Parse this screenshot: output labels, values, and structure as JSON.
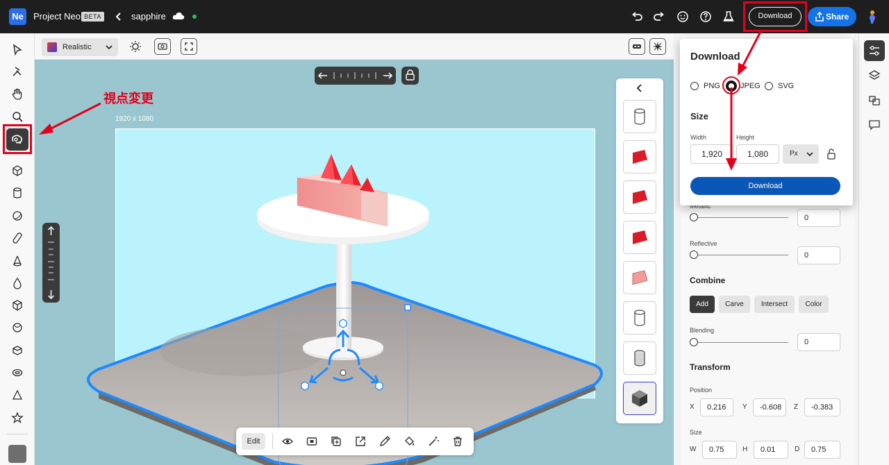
{
  "app": {
    "logo": "Ne",
    "name": "Project Neo",
    "badge": "BETA",
    "document": "sapphire"
  },
  "topbar": {
    "download_label": "Download",
    "share_label": "Share",
    "icons": [
      "back-icon",
      "cloud-icon",
      "undo-icon",
      "redo-icon",
      "emoji-icon",
      "help-icon",
      "flask-icon",
      "profile-icon"
    ]
  },
  "left_tools": [
    "select-icon",
    "pen-icon",
    "hand-icon",
    "zoom-icon",
    "orbit-icon",
    "cube-icon",
    "cylinder-icon",
    "sphere-icon",
    "capsule-icon",
    "cone-icon",
    "drop-icon",
    "box-icon",
    "torus-icon",
    "ring-icon",
    "pyramid-icon",
    "star-icon"
  ],
  "subtoolbar": {
    "render_mode": "Realistic"
  },
  "canvas": {
    "artboard_size": "1920 x 1080",
    "annotation": "視点変更",
    "background": "#9ac6cf",
    "artboard_color": "#baf3fb"
  },
  "action_bar": {
    "edit_label": "Edit",
    "icons": [
      "eye-icon",
      "capture-icon",
      "duplicate-icon",
      "export-icon",
      "eyedropper-icon",
      "fill-icon",
      "magic-icon",
      "trash-icon"
    ]
  },
  "download_popover": {
    "title": "Download",
    "formats": [
      {
        "label": "PNG",
        "selected": false
      },
      {
        "label": "JPEG",
        "selected": true
      },
      {
        "label": "SVG",
        "selected": false
      }
    ],
    "size_heading": "Size",
    "width_label": "Width",
    "height_label": "Height",
    "width": "1,920",
    "height": "1,080",
    "unit": "Px",
    "button": "Download"
  },
  "properties": {
    "metallic_label": "Metallic",
    "metallic_value": "0",
    "reflective_label": "Reflective",
    "reflective_value": "0",
    "combine_heading": "Combine",
    "combine_options": [
      {
        "label": "Add",
        "active": true
      },
      {
        "label": "Carve",
        "active": false
      },
      {
        "label": "Intersect",
        "active": false
      },
      {
        "label": "Color",
        "active": false
      }
    ],
    "blending_label": "Blending",
    "blending_value": "0",
    "transform_heading": "Transform",
    "position_label": "Position",
    "position": {
      "x": "0.216",
      "y": "-0.608",
      "z": "-0.383"
    },
    "size_label": "Size",
    "size": {
      "w": "0.75",
      "h": "0.01",
      "d": "0.75"
    },
    "axis_labels": {
      "x": "X",
      "y": "Y",
      "z": "Z",
      "w": "W",
      "h": "H",
      "d": "D"
    }
  },
  "colors": {
    "accent": "#1473e6",
    "annotation": "#e4001b",
    "selection": "#1e90ff",
    "dark": "#1e1e1e"
  }
}
